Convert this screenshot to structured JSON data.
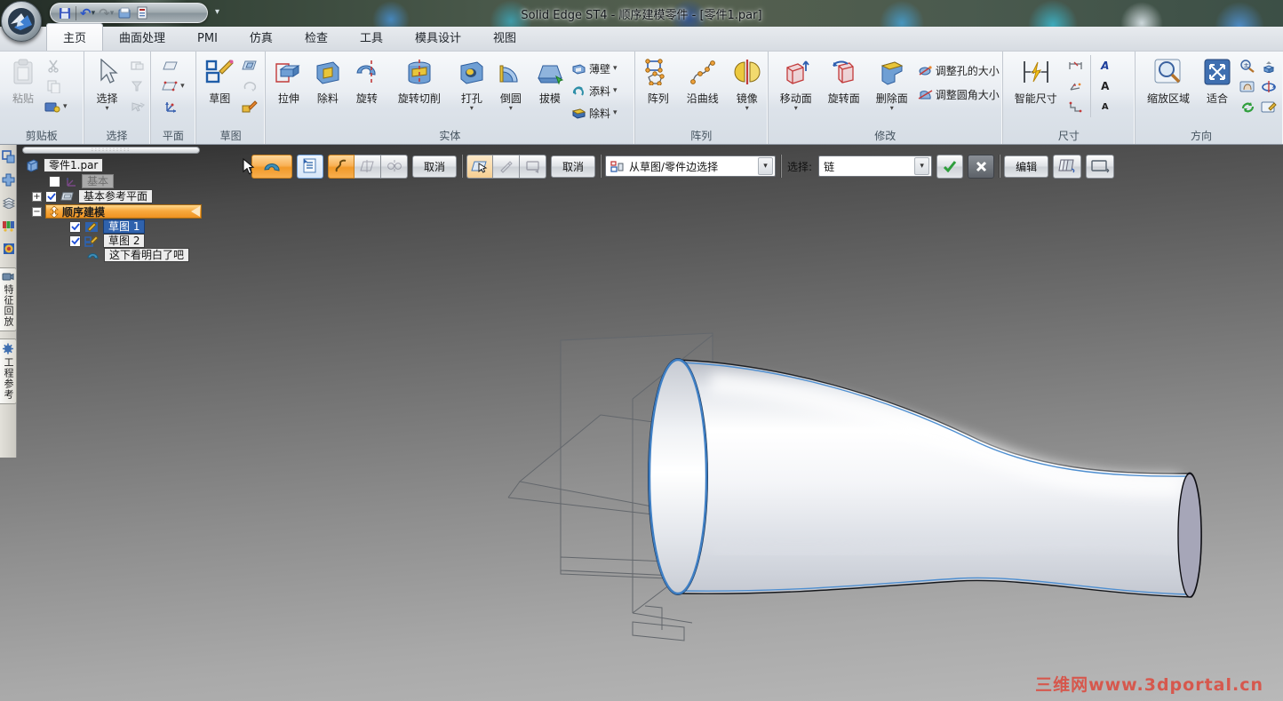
{
  "window": {
    "title": "Solid Edge ST4 - 顺序建模零件 - [零件1.par]"
  },
  "quick_access": {
    "icons": [
      "save",
      "undo",
      "redo",
      "open",
      "print-preview",
      "customize"
    ]
  },
  "tabs": {
    "items": [
      {
        "label": "主页",
        "active": true
      },
      {
        "label": "曲面处理"
      },
      {
        "label": "PMI"
      },
      {
        "label": "仿真"
      },
      {
        "label": "检查"
      },
      {
        "label": "工具"
      },
      {
        "label": "模具设计"
      },
      {
        "label": "视图"
      }
    ]
  },
  "ribbon": {
    "groups": [
      {
        "label": "剪贴板",
        "big": [
          {
            "label": "粘贴"
          }
        ],
        "icons": [
          "cut",
          "copy",
          "format-painter"
        ]
      },
      {
        "label": "选择",
        "big": [
          {
            "label": "选择"
          }
        ],
        "icons": [
          "select-window",
          "select-filter",
          "select-toggle"
        ]
      },
      {
        "label": "平面",
        "big": [],
        "icons": [
          "plane",
          "plane-more",
          "coordinate-system"
        ]
      },
      {
        "label": "草图",
        "big": [
          {
            "label": "草图"
          }
        ],
        "icons": [
          "sketch-plane",
          "sketch-rotate",
          "sketch-edit"
        ]
      },
      {
        "label": "实体",
        "big": [
          {
            "label": "拉伸"
          },
          {
            "label": "除料"
          },
          {
            "label": "旋转"
          },
          {
            "label": "旋转切削"
          },
          {
            "label": "打孔"
          },
          {
            "label": "倒圆"
          },
          {
            "label": "拔模"
          }
        ],
        "small": [
          {
            "label": "薄壁"
          },
          {
            "label": "添料"
          },
          {
            "label": "除料"
          }
        ]
      },
      {
        "label": "阵列",
        "big": [
          {
            "label": "阵列"
          },
          {
            "label": "沿曲线"
          },
          {
            "label": "镜像"
          }
        ]
      },
      {
        "label": "修改",
        "big": [
          {
            "label": "移动面"
          },
          {
            "label": "旋转面"
          },
          {
            "label": "删除面"
          }
        ],
        "small": [
          {
            "label": "调整孔的大小"
          },
          {
            "label": "调整圆角大小"
          }
        ]
      },
      {
        "label": "尺寸",
        "big": [
          {
            "label": "智能尺寸"
          }
        ]
      },
      {
        "label": "方向",
        "big": [
          {
            "label": "缩放区域"
          },
          {
            "label": "适合"
          }
        ],
        "icons": [
          "zoom",
          "pan",
          "refresh-view",
          "common-views",
          "rotate-view",
          "view-styles"
        ]
      }
    ]
  },
  "command_bar": {
    "cancel1": "取消",
    "cancel2": "取消",
    "edge_select": "从草图/零件边选择",
    "select_label": "选择:",
    "select_value": "链",
    "edit": "编辑"
  },
  "pathfinder": {
    "root": "零件1.par",
    "items": [
      {
        "label": "基本",
        "checked": false,
        "disabled": true
      },
      {
        "label": "基本参考平面",
        "checked": true
      },
      {
        "label": "顺序建模",
        "banner": true
      },
      {
        "label": "草图 1",
        "checked": true,
        "selected": true
      },
      {
        "label": "草图 2",
        "checked": true
      },
      {
        "label": "这下看明白了吧"
      }
    ]
  },
  "edgebar": {
    "tabs": [
      {
        "label": "特征回放"
      },
      {
        "label": "工程参考"
      }
    ]
  },
  "watermark": {
    "text": "三维网www.3dportal.cn",
    "color": "#df4134"
  },
  "glyphs": {
    "dropdown": "▾",
    "plus": "+",
    "minus": "−",
    "undo": "↶",
    "redo": "↷"
  },
  "colors": {
    "accent_orange": "#f7a13b",
    "selection_blue": "#2f62ad",
    "edge_highlight": "#4f8fd0",
    "viewport_top": "#2e2e2e",
    "viewport_bottom": "#b9b9b9"
  }
}
